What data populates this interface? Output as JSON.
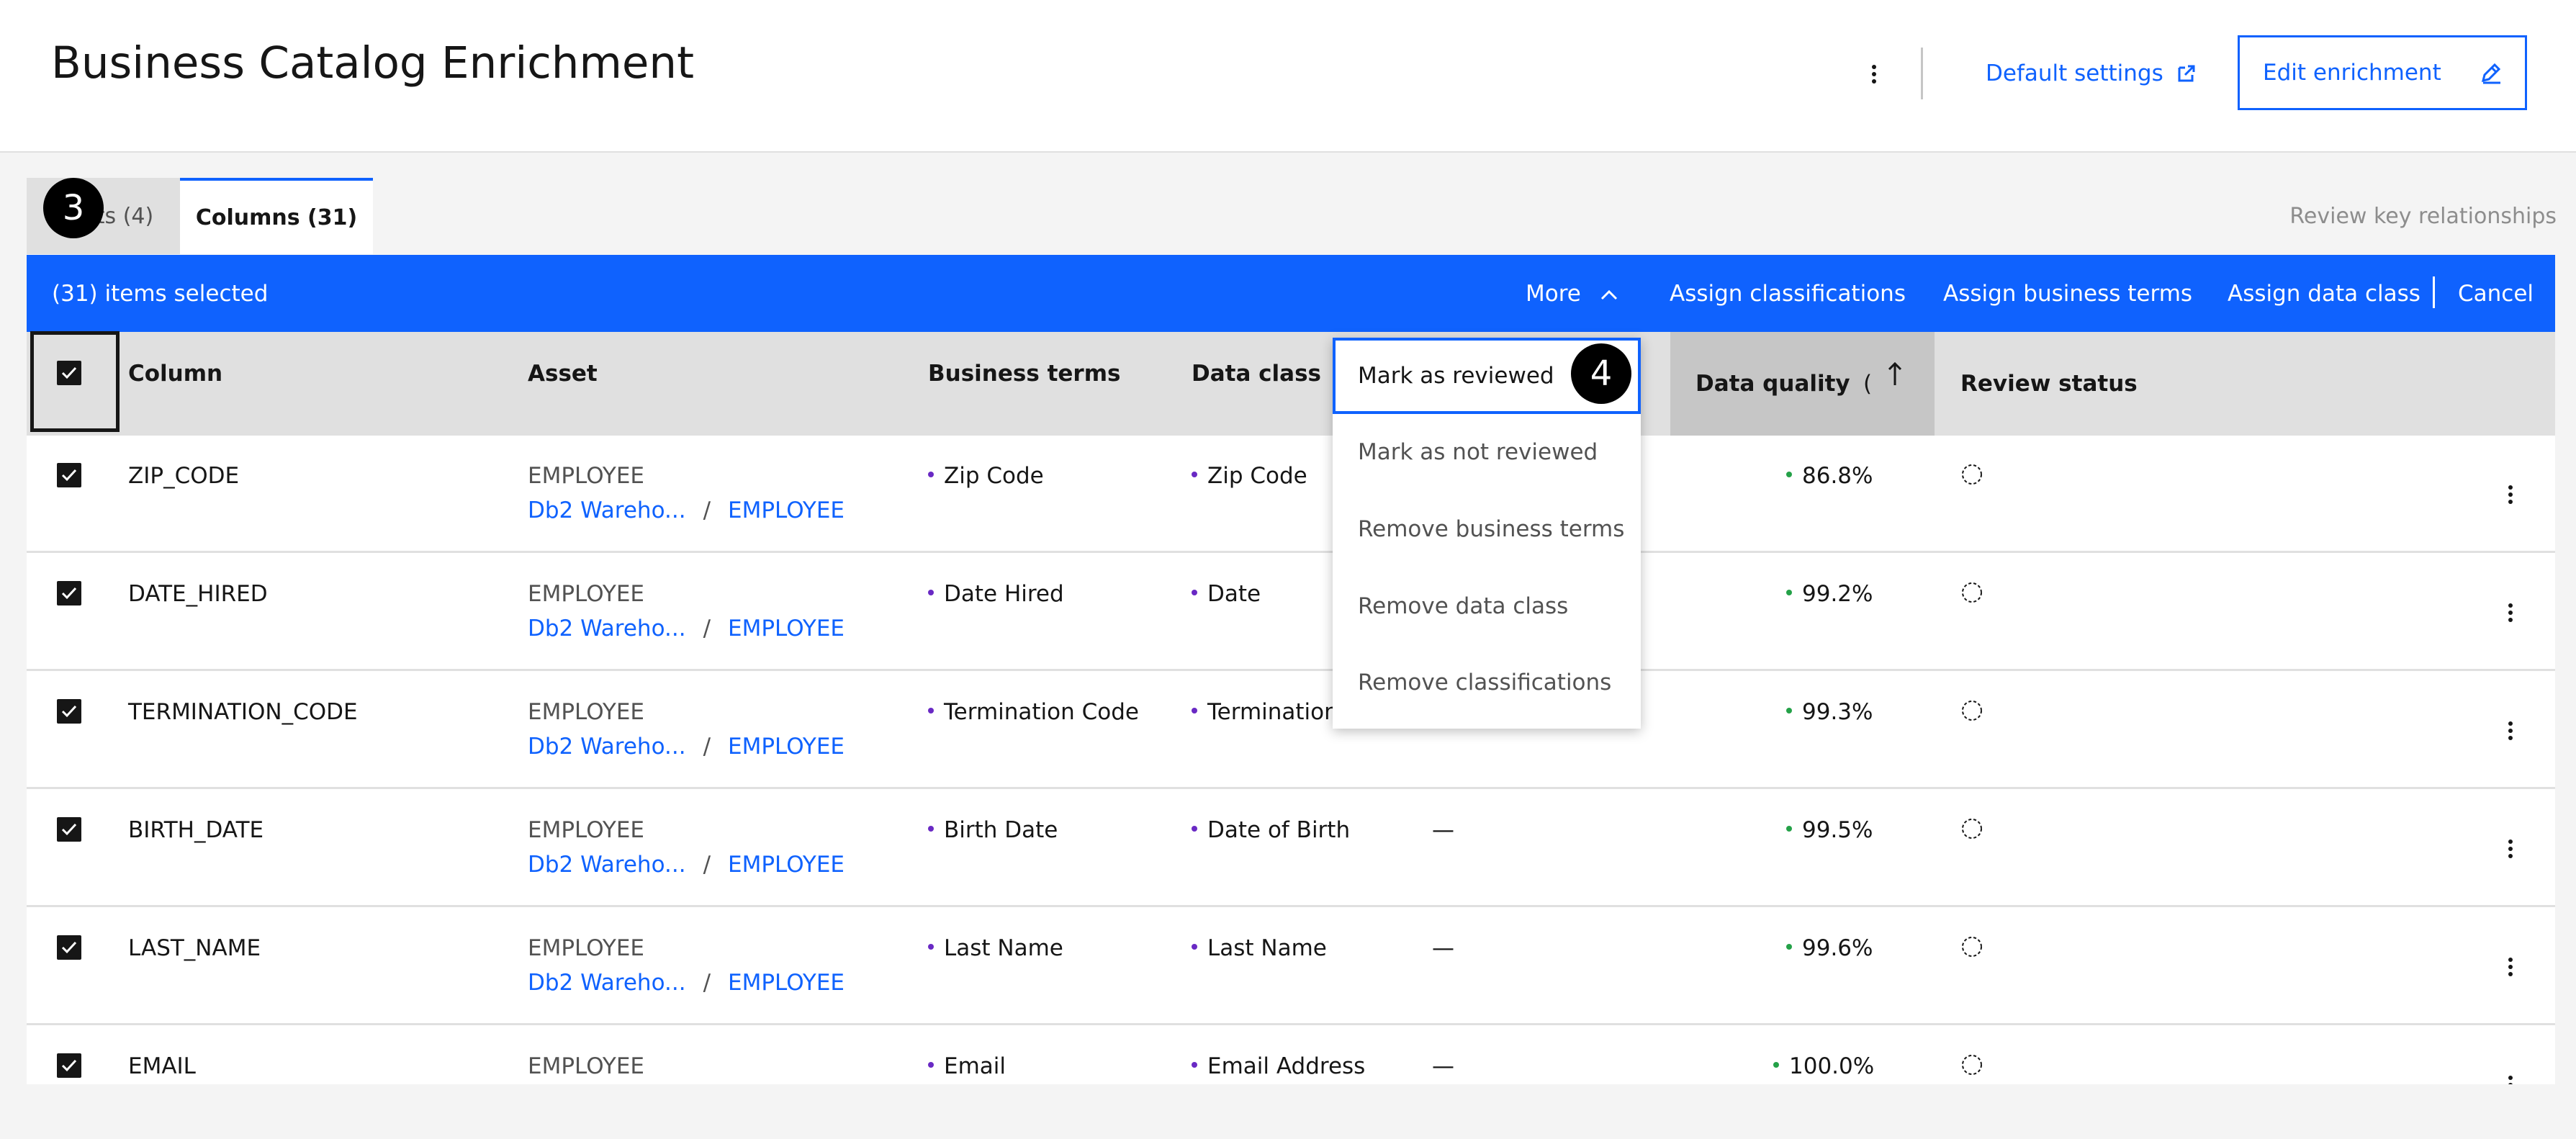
{
  "app": {
    "title": "Business Catalog Enrichment",
    "default_settings_label": "Default settings",
    "edit_enrichment_label": "Edit enrichment"
  },
  "tabs": [
    {
      "label": "Assets (4)",
      "visible_fragment": "ts (4)",
      "selected": false
    },
    {
      "label": "Columns (31)",
      "selected": true
    }
  ],
  "review_key_relationships": "Review key relationships",
  "action_bar": {
    "selected_count": "(31) items selected",
    "more_label": "More",
    "assign_classifications": "Assign classifications",
    "assign_business_terms": "Assign business terms",
    "assign_data_class": "Assign data class",
    "cancel": "Cancel"
  },
  "table": {
    "headers": {
      "column": "Column",
      "asset": "Asset",
      "business_terms": "Business terms",
      "data_class": "Data class",
      "data_quality": "Data quality",
      "data_quality_fragment": "(",
      "review_status": "Review status"
    },
    "rows": [
      {
        "column": "ZIP_CODE",
        "asset": "EMPLOYEE",
        "asset_path_1": "Db2 Wareho...",
        "asset_path_2": "EMPLOYEE",
        "business_term": "Zip Code",
        "data_class": "Zip Code",
        "classification": "",
        "data_quality": "86.8%"
      },
      {
        "column": "DATE_HIRED",
        "asset": "EMPLOYEE",
        "asset_path_1": "Db2 Wareho...",
        "asset_path_2": "EMPLOYEE",
        "business_term": "Date Hired",
        "data_class": "Date",
        "classification": "",
        "data_quality": "99.2%"
      },
      {
        "column": "TERMINATION_CODE",
        "asset": "EMPLOYEE",
        "asset_path_1": "Db2 Wareho...",
        "asset_path_2": "EMPLOYEE",
        "business_term": "Termination Code",
        "data_class": "Termination",
        "classification": "",
        "data_quality": "99.3%"
      },
      {
        "column": "BIRTH_DATE",
        "asset": "EMPLOYEE",
        "asset_path_1": "Db2 Wareho...",
        "asset_path_2": "EMPLOYEE",
        "business_term": "Birth Date",
        "data_class": "Date of Birth",
        "classification": "—",
        "data_quality": "99.5%"
      },
      {
        "column": "LAST_NAME",
        "asset": "EMPLOYEE",
        "asset_path_1": "Db2 Wareho...",
        "asset_path_2": "EMPLOYEE",
        "business_term": "Last Name",
        "data_class": "Last Name",
        "classification": "—",
        "data_quality": "99.6%"
      },
      {
        "column": "EMAIL",
        "asset": "EMPLOYEE",
        "asset_path_1": "",
        "asset_path_2": "",
        "business_term": "Email",
        "data_class": "Email Address",
        "classification": "—",
        "data_quality": "100.0%"
      }
    ]
  },
  "more_menu": {
    "items": [
      "Mark as reviewed",
      "Mark as not reviewed",
      "Remove business terms",
      "Remove data class",
      "Remove classifications"
    ]
  },
  "annotations": {
    "step_3": "3",
    "step_4": "4"
  },
  "colors": {
    "accent": "#0f62fe",
    "term_dot": "#6929c4",
    "quality_dot": "#24a148"
  }
}
